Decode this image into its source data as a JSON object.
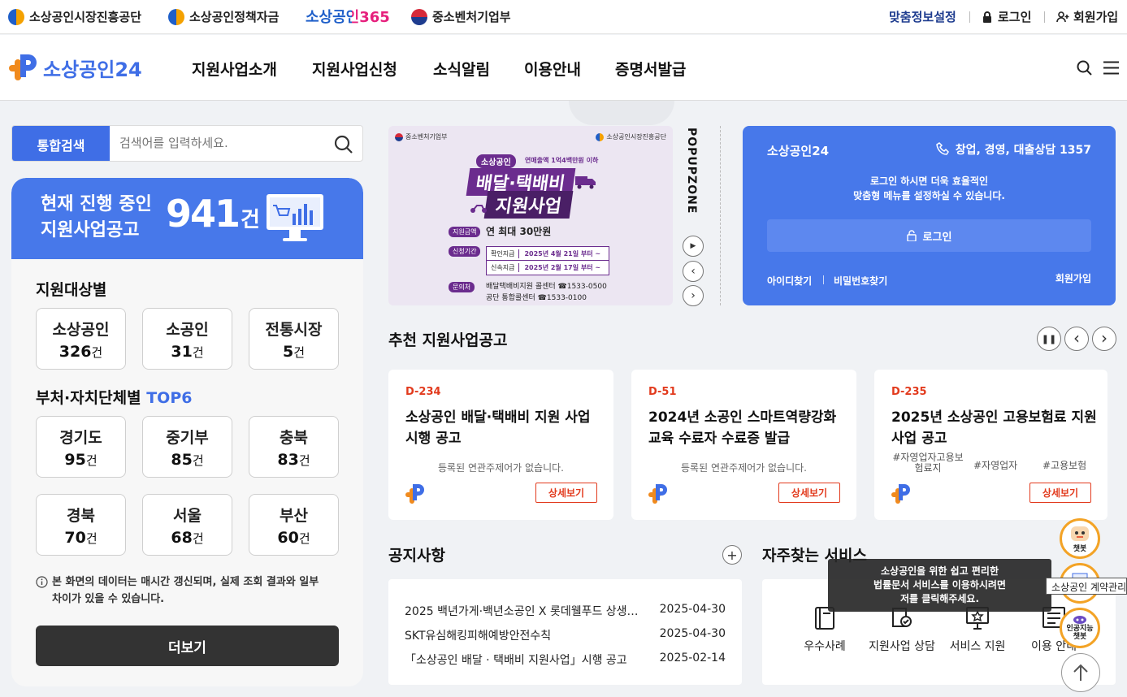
{
  "util": {
    "links": [
      "소상공인시장진흥공단",
      "소상공인정책자금",
      "중소벤처기업부"
    ],
    "brand365": "소상공인365",
    "custom": "맞춤정보설정",
    "login": "로그인",
    "signup": "회원가입"
  },
  "nav": {
    "logo": "소상공인24",
    "menus": [
      "지원사업소개",
      "지원사업신청",
      "소식알림",
      "이용안내",
      "증명서발급"
    ]
  },
  "search": {
    "button": "통합검색",
    "placeholder": "검색어를 입력하세요."
  },
  "summary": {
    "line1": "현재 진행 중인",
    "line2": "지원사업공고",
    "count": "941",
    "unit": "건"
  },
  "by_target": {
    "title": "지원대상별",
    "items": [
      {
        "name": "소상공인",
        "count": "326",
        "unit": "건"
      },
      {
        "name": "소공인",
        "count": "31",
        "unit": "건"
      },
      {
        "name": "전통시장",
        "count": "5",
        "unit": "건"
      }
    ]
  },
  "by_region": {
    "title": "부처·자치단체별",
    "title_accent": "TOP6",
    "items": [
      {
        "name": "경기도",
        "count": "95",
        "unit": "건"
      },
      {
        "name": "중기부",
        "count": "85",
        "unit": "건"
      },
      {
        "name": "충북",
        "count": "83",
        "unit": "건"
      },
      {
        "name": "경북",
        "count": "70",
        "unit": "건"
      },
      {
        "name": "서울",
        "count": "68",
        "unit": "건"
      },
      {
        "name": "부산",
        "count": "60",
        "unit": "건"
      }
    ]
  },
  "panel_note_line1": "본 화면의 데이터는 매시간 갱신되며, 실제 조회 결과와 일부",
  "panel_note_line2": "차이가 있을 수 있습니다.",
  "more_button": "더보기",
  "popup": {
    "org_left": "중소벤처기업부",
    "org_right": "소상공인시장진흥공단",
    "badge": "소상공인",
    "sub": "연매출액 1억4백만원 이하",
    "title1": "배달·택배비",
    "title2": "지원사업",
    "amount_label": "지원금액",
    "amount": "연 최대 30만원",
    "period_label": "신청기간",
    "period1_tag": "확인지급",
    "period1": "2025년 4월 21일 부터 ~",
    "period2_tag": "신속지급",
    "period2": "2025년 2월 17일 부터 ~",
    "contact_label": "문의처",
    "contact1": "배달택배비지원 콜센터 ☎1533-0500",
    "contact2": "공단 통합콜센터 ☎1533-0100",
    "zone_label": "POPUPZONE"
  },
  "login_card": {
    "title": "소상공인24",
    "phone": "창업, 경영, 대출상담 1357",
    "msg1": "로그인 하시면 더욱 효율적인",
    "msg2": "맞춤형 메뉴를 설정하실 수 있습니다.",
    "login_btn": "로그인",
    "find_id": "아이디찾기",
    "find_pw": "비밀번호찾기",
    "signup": "회원가입"
  },
  "recommend": {
    "title": "추천 지원사업공고",
    "cards": [
      {
        "dday": "D-234",
        "title": "소상공인 배달·택배비 지원 사업 시행 공고",
        "note": "등록된 연관주제어가 없습니다.",
        "btn": "상세보기"
      },
      {
        "dday": "D-51",
        "title": "2024년 소공인 스마트역량강화 교육 수료자 수료증 발급",
        "note": "등록된 연관주제어가 없습니다.",
        "btn": "상세보기"
      },
      {
        "dday": "D-235",
        "title": "2025년 소상공인 고용보험료 지원사업 공고",
        "tags": [
          "#자영업자고용보험료지",
          "#자영업자",
          "#고용보험"
        ],
        "btn": "상세보기"
      }
    ]
  },
  "notice": {
    "title": "공지사항",
    "rows": [
      {
        "text": "2025 백년가게·백년소공인 X 롯데웰푸드 상생…",
        "date": "2025-04-30"
      },
      {
        "text": "SKT유심해킹피해예방안전수칙",
        "date": "2025-04-30"
      },
      {
        "text": "「소상공인 배달 · 택배비 지원사업」시행 공고",
        "date": "2025-02-14"
      }
    ]
  },
  "services": {
    "title": "자주찾는 서비스",
    "tooltip1": "소상공인을 위한 쉽고 편리한",
    "tooltip2": "법률문서 서비스를 이용하시려면",
    "tooltip3": "저를 클릭해주세요.",
    "items": [
      "우수사례",
      "지원사업 상담",
      "서비스 지원",
      "이용 안내"
    ]
  },
  "floating": {
    "chatbot": "챗봇",
    "contract": "소상공인 계약관리",
    "ai_chatbot1": "인공지능",
    "ai_chatbot2": "챗봇"
  },
  "colors": {
    "primary": "#4778ea",
    "accent": "#e23a1d",
    "dark": "#333333"
  }
}
